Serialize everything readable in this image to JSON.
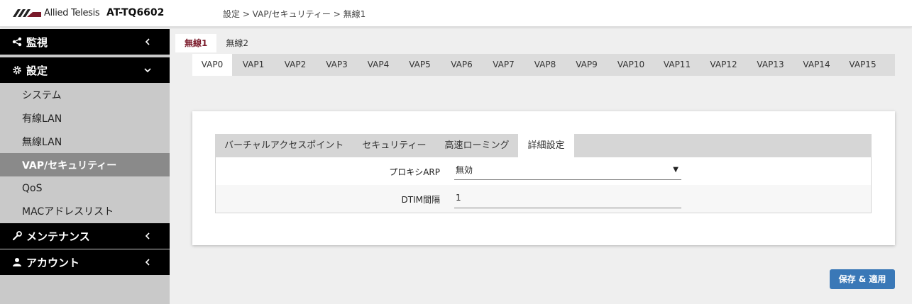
{
  "header": {
    "brand": "Allied Telesis",
    "model": "AT-TQ6602",
    "breadcrumb": "設定 > VAP/セキュリティー > 無線1",
    "brand_color": "#7a1a2a"
  },
  "sidebar": {
    "monitor": {
      "label": "監視",
      "icon": "share-icon"
    },
    "settings": {
      "label": "設定",
      "icon": "gear-icon",
      "items": [
        {
          "label": "システム"
        },
        {
          "label": "有線LAN"
        },
        {
          "label": "無線LAN"
        },
        {
          "label": "VAP/セキュリティー"
        },
        {
          "label": "QoS"
        },
        {
          "label": "MACアドレスリスト"
        }
      ],
      "active_item": "VAP/セキュリティー"
    },
    "maintenance": {
      "label": "メンテナンス",
      "icon": "wrench-icon"
    },
    "account": {
      "label": "アカウント",
      "icon": "user-icon"
    }
  },
  "radio_tabs": [
    {
      "label": "無線1"
    },
    {
      "label": "無線2"
    }
  ],
  "vap_tabs": [
    "VAP0",
    "VAP1",
    "VAP2",
    "VAP3",
    "VAP4",
    "VAP5",
    "VAP6",
    "VAP7",
    "VAP8",
    "VAP9",
    "VAP10",
    "VAP11",
    "VAP12",
    "VAP13",
    "VAP14",
    "VAP15"
  ],
  "sub_tabs": [
    {
      "label": "バーチャルアクセスポイント"
    },
    {
      "label": "セキュリティー"
    },
    {
      "label": "高速ローミング"
    },
    {
      "label": "詳細設定"
    }
  ],
  "form": {
    "proxy_arp": {
      "label": "プロキシARP",
      "value": "無効"
    },
    "dtim": {
      "label": "DTIM間隔",
      "value": "1"
    }
  },
  "save_label": "保存 & 適用",
  "accent_color": "#3a78b7"
}
